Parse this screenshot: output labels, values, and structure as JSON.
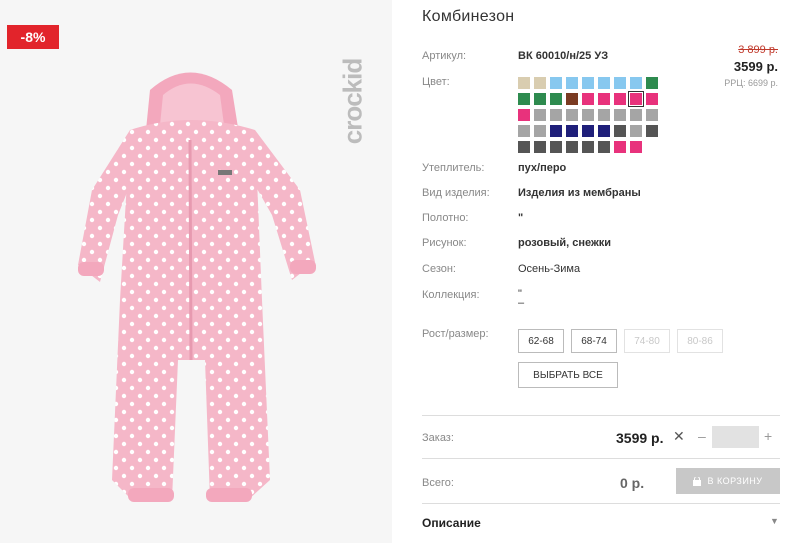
{
  "badge": "-8%",
  "brand": "crockid",
  "title": "Комбинезон",
  "price": {
    "old": "3 899 р.",
    "current": "3599 р.",
    "rrp": "РРЦ: 6699 р."
  },
  "specs": {
    "article": {
      "label": "Артикул:",
      "value": "ВК 60010/н/25 УЗ"
    },
    "color": {
      "label": "Цвет:"
    },
    "insulation": {
      "label": "Утеплитель:",
      "value": "пух/перо"
    },
    "kind": {
      "label": "Вид изделия:",
      "value": "Изделия из мембраны"
    },
    "fabric": {
      "label": "Полотно:",
      "value": "\""
    },
    "pattern": {
      "label": "Рисунок:",
      "value": "розовый, снежки"
    },
    "season": {
      "label": "Сезон:",
      "value": "Осень-Зима"
    },
    "collection": {
      "label": "Коллекция:",
      "value": "\"",
      "value2": "–"
    }
  },
  "swatches": [
    "#d9cdb0",
    "#d9cdb0",
    "#87c8ef",
    "#87c8ef",
    "#87c8ef",
    "#87c8ef",
    "#87c8ef",
    "#87c8ef",
    "#2e8b4f",
    "#2e8b4f",
    "#2e8b4f",
    "#2e8b4f",
    "#7a3b22",
    "#e8327c",
    "#e8327c",
    "#e8327c",
    "#e8327c",
    "#e8327c",
    "#e8327c",
    "#a5a5a5",
    "#a5a5a5",
    "#a5a5a5",
    "#a5a5a5",
    "#a5a5a5",
    "#a5a5a5",
    "#a5a5a5",
    "#a5a5a5",
    "#a5a5a5",
    "#a5a5a5",
    "#1f1f7a",
    "#1f1f7a",
    "#1f1f7a",
    "#1f1f7a",
    "#555555",
    "#a5a5a5",
    "#555555",
    "#555555",
    "#555555",
    "#555555",
    "#555555",
    "#555555",
    "#555555",
    "#e8327c",
    "#e8327c"
  ],
  "selected_swatch": 16,
  "size": {
    "label": "Рост/размер:",
    "options": [
      {
        "label": "62-68",
        "available": true
      },
      {
        "label": "68-74",
        "available": true
      },
      {
        "label": "74-80",
        "available": false
      },
      {
        "label": "80-86",
        "available": false
      }
    ],
    "select_all": "ВЫБРАТЬ ВСЕ"
  },
  "order": {
    "label": "Заказ:",
    "price": "3599 р.",
    "remove": "✕",
    "minus": "–",
    "plus": "+"
  },
  "total": {
    "label": "Всего:",
    "value": "0 р.",
    "cart_button": "В КОРЗИНУ"
  },
  "description": {
    "label": "Описание",
    "caret": "▼"
  }
}
